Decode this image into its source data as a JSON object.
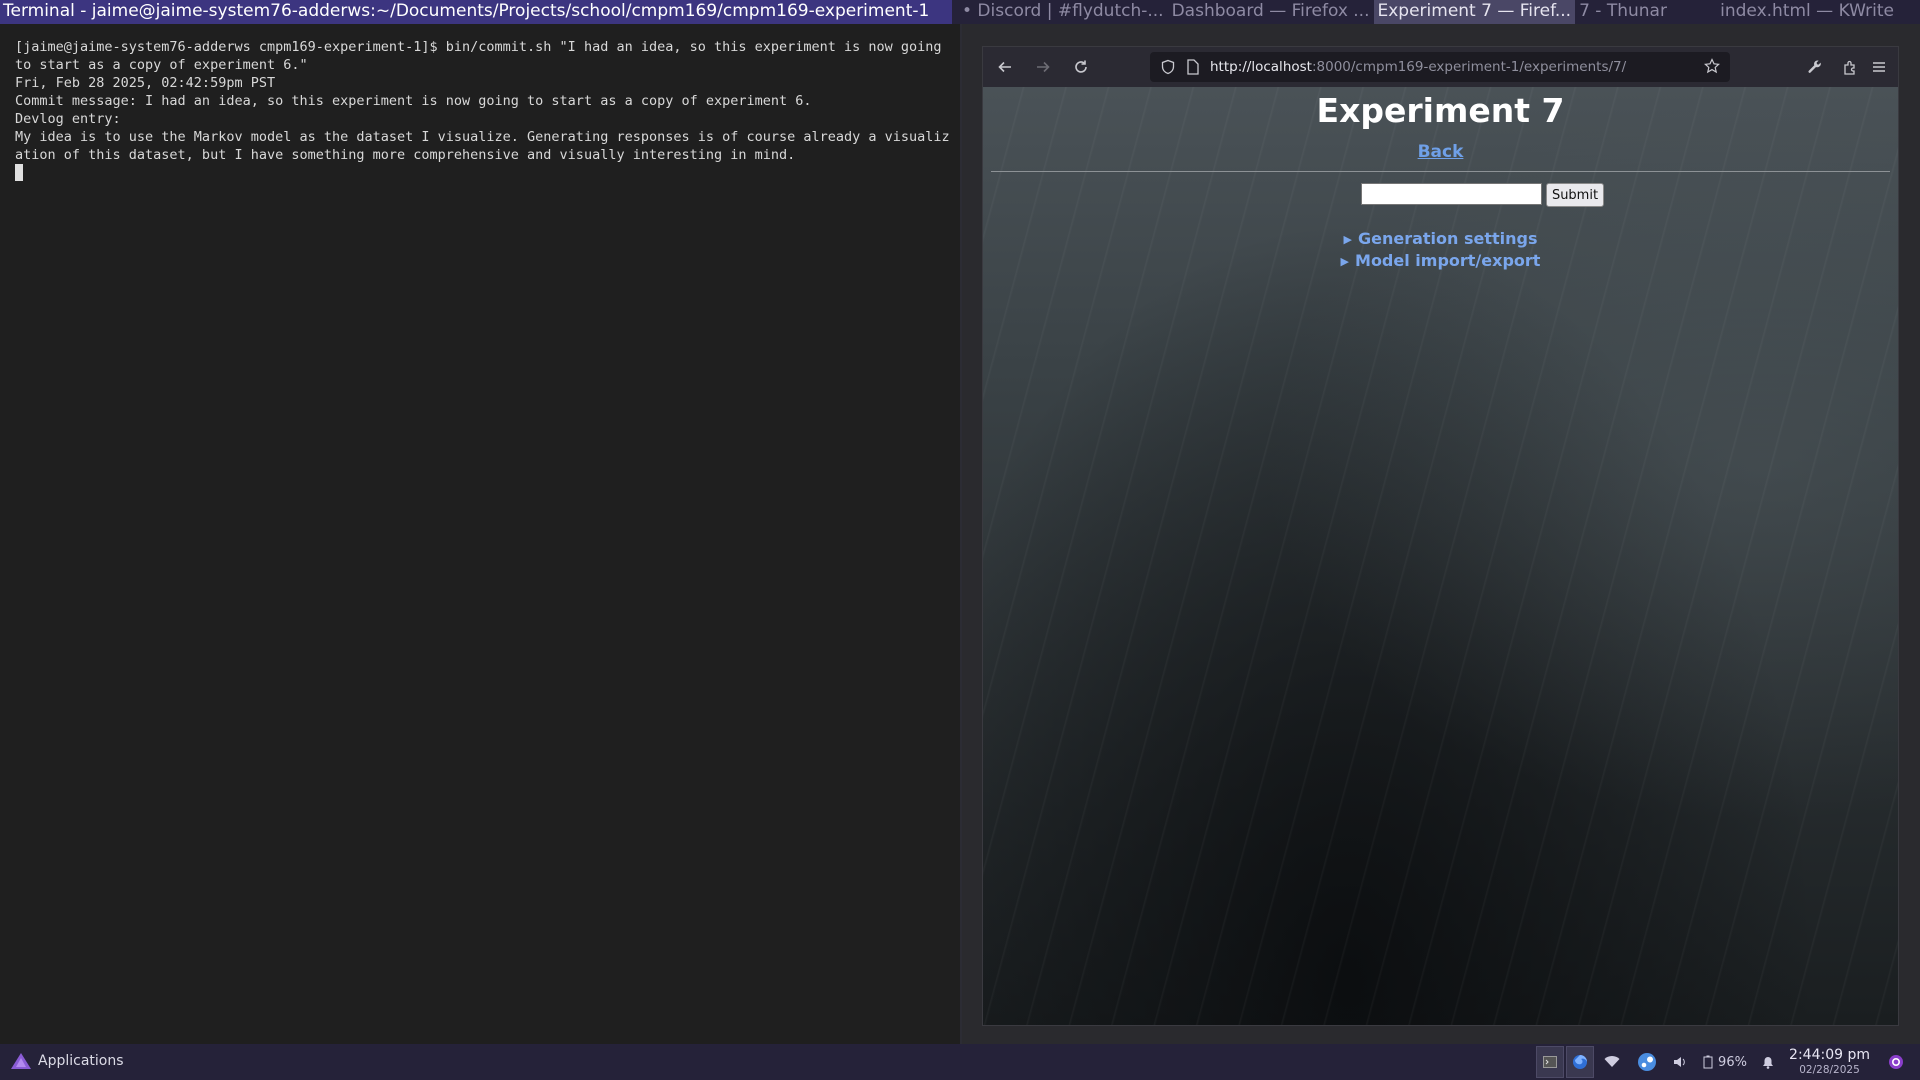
{
  "topbar": {
    "terminal_title": "Terminal - jaime@jaime-system76-adderws:~/Documents/Projects/school/cmpm169/cmpm169-experiment-1",
    "windows": [
      "• Discord | #flydutch-...",
      "Dashboard — Firefox ...",
      "Experiment 7 — Firef...",
      "7 - Thunar"
    ],
    "right_window": "index.html  — KWrite"
  },
  "terminal": {
    "lines": [
      "[jaime@jaime-system76-adderws cmpm169-experiment-1]$ bin/commit.sh \"I had an idea, so this experiment is now going to start as a copy of experiment 6.\"",
      "Fri, Feb 28 2025, 02:42:59pm PST",
      "Commit message: I had an idea, so this experiment is now going to start as a copy of experiment 6.",
      "Devlog entry:",
      "My idea is to use the Markov model as the dataset I visualize. Generating responses is of course already a visualization of this dataset, but I have something more comprehensive and visually interesting in mind."
    ]
  },
  "browser": {
    "url_host": "http://localhost",
    "url_path": ":8000/cmpm169-experiment-1/experiments/7/",
    "icons": [
      "back-icon",
      "forward-icon",
      "reload-icon",
      "shield-icon",
      "page-icon",
      "star-icon",
      "wrench-icon",
      "extensions-icon",
      "menu-icon"
    ]
  },
  "page": {
    "title": "Experiment 7",
    "back_link": "Back",
    "input_value": "",
    "submit_label": "Submit",
    "generation_settings": "Generation settings",
    "model_import_export": "Model import/export"
  },
  "taskbar": {
    "applications_label": "Applications",
    "battery": "96%",
    "time": "2:44:09 pm",
    "date": "02/28/2025"
  },
  "colors": {
    "title_bar_active": "#3c3580",
    "panel_bg": "#252239",
    "link": "#6fa0e8"
  }
}
